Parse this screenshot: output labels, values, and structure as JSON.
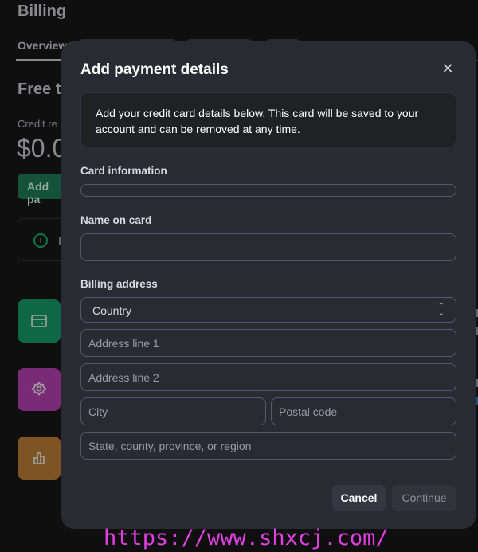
{
  "background": {
    "title": "Billing",
    "active_tab": "Overview",
    "section_title": "Free tr",
    "credit_label": "Credit re",
    "credit_amount": "$0.0",
    "add_button": "Add pa",
    "info_text": "I",
    "tiles": [
      {
        "icon": "credit-card-icon",
        "color": "#0e6848"
      },
      {
        "icon": "gear-icon",
        "color": "#7a2b78"
      },
      {
        "icon": "bar-chart-icon",
        "color": "#7f5425"
      }
    ]
  },
  "modal": {
    "title": "Add payment details",
    "notice": "Add your credit card details below. This card will be saved to your account and can be removed at any time.",
    "card_label": "Card information",
    "card_value": "",
    "name_label": "Name on card",
    "name_value": "",
    "billing_label": "Billing address",
    "country": "Country",
    "address1_placeholder": "Address line 1",
    "address2_placeholder": "Address line 2",
    "city_placeholder": "City",
    "postal_placeholder": "Postal code",
    "state_placeholder": "State, county, province, or region",
    "cancel": "Cancel",
    "continue": "Continue"
  },
  "watermark": "https://www.shxcj.com/",
  "colors": {
    "accent": "#10a37f",
    "modal_bg": "#2a2b32",
    "page_bg": "#0f0f10"
  }
}
